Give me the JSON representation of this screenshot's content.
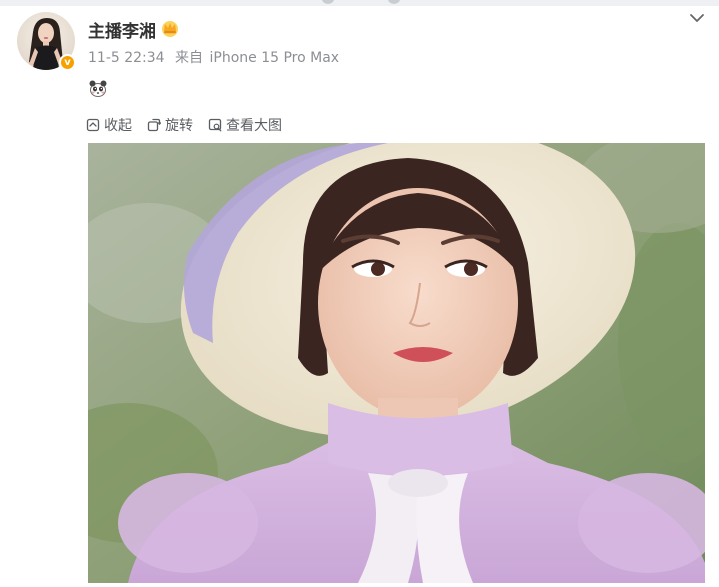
{
  "post": {
    "author": "主播李湘",
    "date": "11-5 22:34",
    "source_prefix": "来自",
    "device": "iPhone 15 Pro Max",
    "verified_badge": "v"
  },
  "toolbar": {
    "collect_label": "收起",
    "rotate_label": "旋转",
    "view_large_label": "查看大图"
  },
  "icons": {
    "crown": "crown-icon",
    "emoji": "panda-emoji-icon",
    "chevron": "chevron-down-icon",
    "collect": "collapse-icon",
    "rotate": "rotate-icon",
    "view_large": "zoom-image-icon"
  },
  "colors": {
    "author": "#333333",
    "meta": "#8b8f94",
    "badge": "#f7a000",
    "toolbar_text": "#5a5d61"
  }
}
